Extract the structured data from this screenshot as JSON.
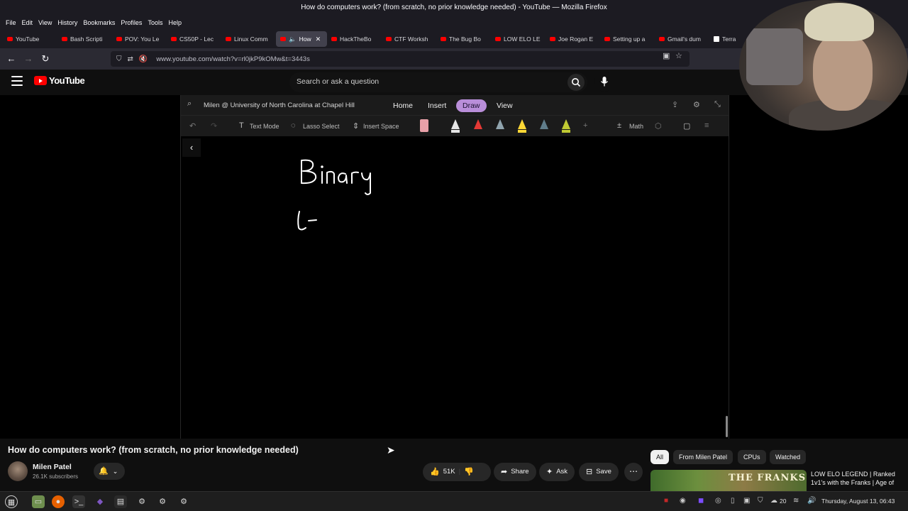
{
  "window": {
    "title": "How do computers work? (from scratch, no prior knowledge needed) - YouTube — Mozilla Firefox"
  },
  "menu": [
    "File",
    "Edit",
    "View",
    "History",
    "Bookmarks",
    "Profiles",
    "Tools",
    "Help"
  ],
  "tabs": [
    {
      "label": "YouTube",
      "icon": "youtube-icon"
    },
    {
      "label": "Bash Scripti",
      "icon": "youtube-icon"
    },
    {
      "label": "POV: You Le",
      "icon": "youtube-icon"
    },
    {
      "label": "CS50P - Lec",
      "icon": "youtube-icon"
    },
    {
      "label": "Linux Comm",
      "icon": "youtube-icon"
    },
    {
      "label": "How",
      "icon": "youtube-icon",
      "active": true
    },
    {
      "label": "HackTheBo",
      "icon": "youtube-icon"
    },
    {
      "label": "CTF Worksh",
      "icon": "youtube-icon"
    },
    {
      "label": "The Bug Bo",
      "icon": "youtube-icon"
    },
    {
      "label": "LOW ELO LE",
      "icon": "youtube-icon"
    },
    {
      "label": "Joe Rogan E",
      "icon": "youtube-icon"
    },
    {
      "label": "Setting up a",
      "icon": "youtube-icon"
    },
    {
      "label": "Gmail's dum",
      "icon": "youtube-icon"
    },
    {
      "label": "Terra",
      "icon": "wikipedia-icon"
    }
  ],
  "nav": {
    "url": "www.youtube.com/watch?v=rl0jkP9kOMw&t=3443s"
  },
  "youtube": {
    "logo_text": "YouTube",
    "search_placeholder": "Search or ask a question"
  },
  "onenote": {
    "notebook": "Milen @ University of North Carolina at Chapel Hill",
    "tabs": [
      "Home",
      "Insert",
      "Draw",
      "View"
    ],
    "active_tab": "Draw",
    "ribbon": {
      "text_mode": "Text Mode",
      "lasso_select": "Lasso Select",
      "insert_space": "Insert Space",
      "math": "Math"
    },
    "pen_colors": [
      "#e8a0a8",
      "#e6e6e6",
      "#e53935",
      "#90a4ae",
      "#fdd835",
      "#607d8b",
      "#c0ca33"
    ],
    "ink_text": "Binary"
  },
  "video": {
    "title": "How do computers work? (from scratch, no prior knowledge needed)",
    "channel": "Milen Patel",
    "subscribers": "26.1K subscribers",
    "likes": "51K",
    "share": "Share",
    "ask": "Ask",
    "save": "Save"
  },
  "chips": [
    "All",
    "From Milen Patel",
    "CPUs",
    "Watched"
  ],
  "recommendation": {
    "thumb_text": "THE FRANKS",
    "title": "LOW ELO LEGEND | Ranked 1v1's with the Franks | Age of"
  },
  "taskbar": {
    "tray_count": "20",
    "clock": "Thursday, August 13, 06:43"
  }
}
